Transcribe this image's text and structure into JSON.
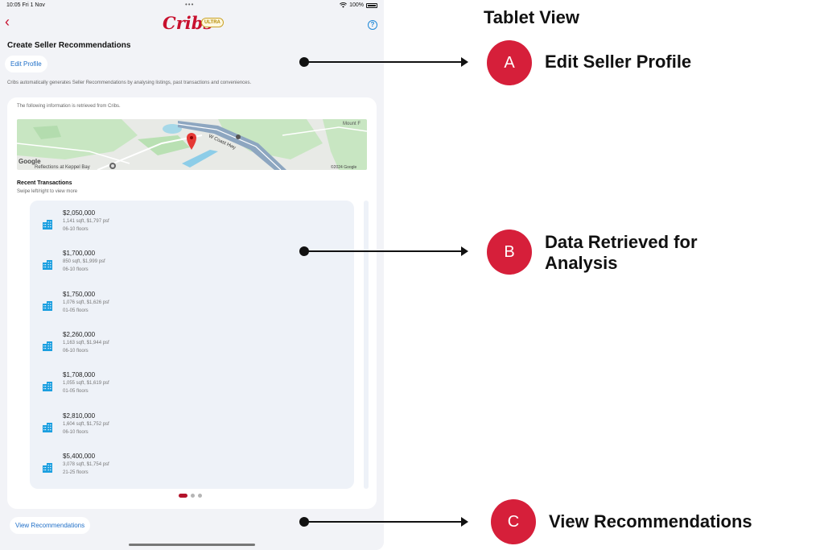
{
  "status": {
    "time": "10:05  Fri 1 Nov",
    "dots": "•••",
    "battery": "100%"
  },
  "nav": {
    "back": "‹",
    "brand": "Cribs",
    "badge": "ULTRA",
    "help": "?"
  },
  "page": {
    "title": "Create Seller Recommendations",
    "edit_profile": "Edit Profile",
    "description": "Cribs automatically generates Seller Recommendations by analysing listings, past transactions and conveniences."
  },
  "card": {
    "note": "The following information is retrieved from Cribs.",
    "map": {
      "attribution": "Google",
      "copyright": "©2024 Google",
      "labels": [
        "W Coast Hwy",
        "Mount F",
        "Reflections at Keppel Bay"
      ]
    },
    "recent_title": "Recent Transactions",
    "recent_hint": "Swipe left/right to view more",
    "transactions": [
      {
        "price": "$2,050,000",
        "detail": "1,141 sqft, $1,797 psf",
        "floors": "06-10 floors"
      },
      {
        "price": "$1,700,000",
        "detail": "850 sqft, $1,999 psf",
        "floors": "06-10 floors"
      },
      {
        "price": "$1,750,000",
        "detail": "1,076 sqft, $1,626 psf",
        "floors": "01-05 floors"
      },
      {
        "price": "$2,260,000",
        "detail": "1,163 sqft, $1,944 psf",
        "floors": "06-10 floors"
      },
      {
        "price": "$1,708,000",
        "detail": "1,055 sqft, $1,619 psf",
        "floors": "01-05 floors"
      },
      {
        "price": "$2,810,000",
        "detail": "1,604 sqft, $1,752 psf",
        "floors": "06-10 floors"
      },
      {
        "price": "$5,400,000",
        "detail": "3,078 sqft, $1,754 psf",
        "floors": "21-25 floors"
      }
    ],
    "pager": {
      "pages": 3,
      "active": 1
    }
  },
  "view_recommendations": "View Recommendations",
  "annotations": {
    "title": "Tablet View",
    "callouts": [
      {
        "badge": "A",
        "label": "Edit Seller Profile"
      },
      {
        "badge": "B",
        "label": "Data Retrieved for Analysis"
      },
      {
        "badge": "C",
        "label": "View Recommendations"
      }
    ]
  },
  "colors": {
    "brand": "#c8102e",
    "link": "#1f6fc8",
    "badge": "#d61f3a",
    "building_icon": "#1a9fe0"
  },
  "icons": {
    "building": "building-icon",
    "map_pin": "map-pin-icon",
    "help": "help-circle-icon",
    "back": "chevron-left-icon"
  }
}
